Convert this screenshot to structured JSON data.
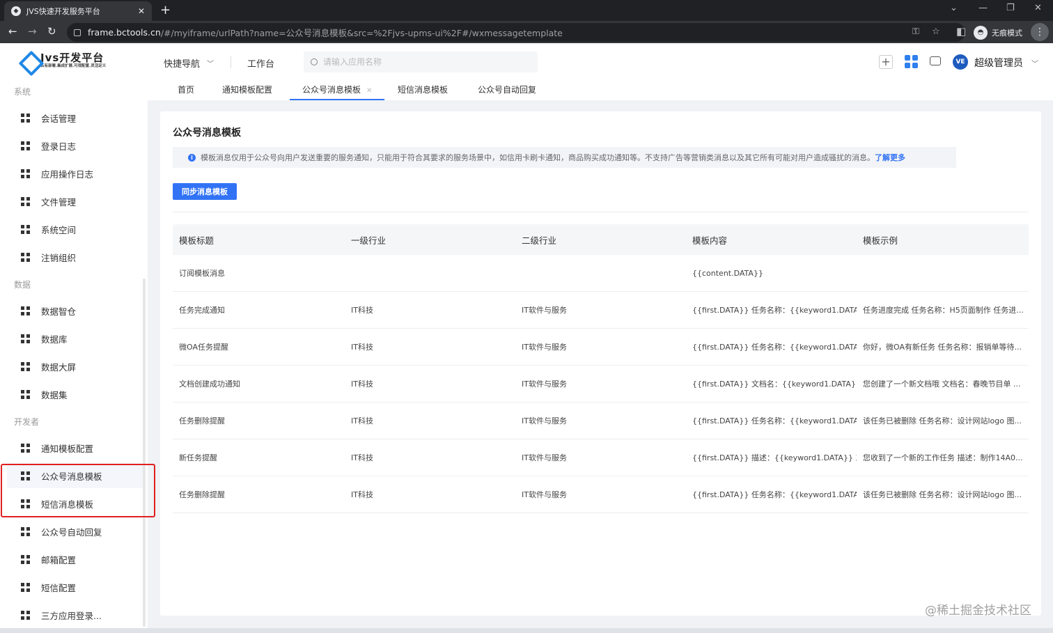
{
  "browser": {
    "tab_title": "JVS快速开发服务平台",
    "url_host": "frame.bctools.cn",
    "url_path": "/#/myiframe/urlPath?name=公众号消息模板&src=%2Fjvs-upms-ui%2F#/wxmessagetemplate",
    "incognito_label": "无痕模式"
  },
  "header": {
    "logo_title": "Jvs开发平台",
    "logo_subtitle": "私有部署.集成扩展.可视配置.灵活定义",
    "quick_nav": "快捷导航",
    "workbench": "工作台",
    "search_placeholder": "请输入应用名称",
    "avatar_text": "VE",
    "username": "超级管理员"
  },
  "sidebar": {
    "groups": [
      {
        "label": "系统",
        "items": [
          "会话管理",
          "登录日志",
          "应用操作日志",
          "文件管理",
          "系统空间",
          "注销组织"
        ]
      },
      {
        "label": "数据",
        "items": [
          "数据智仓",
          "数据库",
          "数据大屏",
          "数据集"
        ]
      },
      {
        "label": "开发者",
        "items": [
          "通知模板配置",
          "公众号消息模板",
          "短信消息模板",
          "公众号自动回复",
          "邮箱配置",
          "短信配置",
          "三方应用登录..."
        ]
      }
    ],
    "active_item": "公众号消息模板"
  },
  "page_tabs": [
    "首页",
    "通知模板配置",
    "公众号消息模板",
    "短信消息模板",
    "公众号自动回复"
  ],
  "active_tab": "公众号消息模板",
  "main": {
    "title": "公众号消息模板",
    "notice": "模板消息仅用于公众号向用户发送重要的服务通知，只能用于符合其要求的服务场景中，如信用卡刷卡通知，商品购买成功通知等。不支持广告等营销类消息以及其它所有可能对用户造成骚扰的消息。",
    "notice_link": "了解更多",
    "sync_button": "同步消息模板",
    "table": {
      "headers": [
        "模板标题",
        "一级行业",
        "二级行业",
        "模板内容",
        "模板示例"
      ],
      "rows": [
        [
          "订阅模板消息",
          "",
          "",
          "{{content.DATA}}",
          ""
        ],
        [
          "任务完成通知",
          "IT科技",
          "IT软件与服务",
          "{{first.DATA}} 任务名称：{{keyword1.DATA...",
          "任务进度完成 任务名称：H5页面制作 任务进..."
        ],
        [
          "微OA任务提醒",
          "IT科技",
          "IT软件与服务",
          "{{first.DATA}} 任务名称：{{keyword1.DATA...",
          "你好，微OA有新任务 任务名称：报销单等待..."
        ],
        [
          "文档创建成功通知",
          "IT科技",
          "IT软件与服务",
          "{{first.DATA}} 文档名：{{keyword1.DATA}} ...",
          "您创建了一个新文档哦 文档名：春晚节目单 ..."
        ],
        [
          "任务删除提醒",
          "IT科技",
          "IT软件与服务",
          "{{first.DATA}} 任务名称：{{keyword1.DATA...",
          "该任务已被删除 任务名称：设计网站logo 图..."
        ],
        [
          "新任务提醒",
          "IT科技",
          "IT软件与服务",
          "{{first.DATA}} 描述：{{keyword1.DATA}} 工...",
          "您收到了一个新的工作任务 描述：制作14A0..."
        ],
        [
          "任务删除提醒",
          "IT科技",
          "IT软件与服务",
          "{{first.DATA}} 任务名称：{{keyword1.DATA...",
          "该任务已被删除 任务名称：设计网站logo 图..."
        ]
      ]
    }
  },
  "watermark": "@稀土掘金技术社区",
  "colors": {
    "accent": "#3273f6",
    "highlight_box": "#e02020"
  }
}
